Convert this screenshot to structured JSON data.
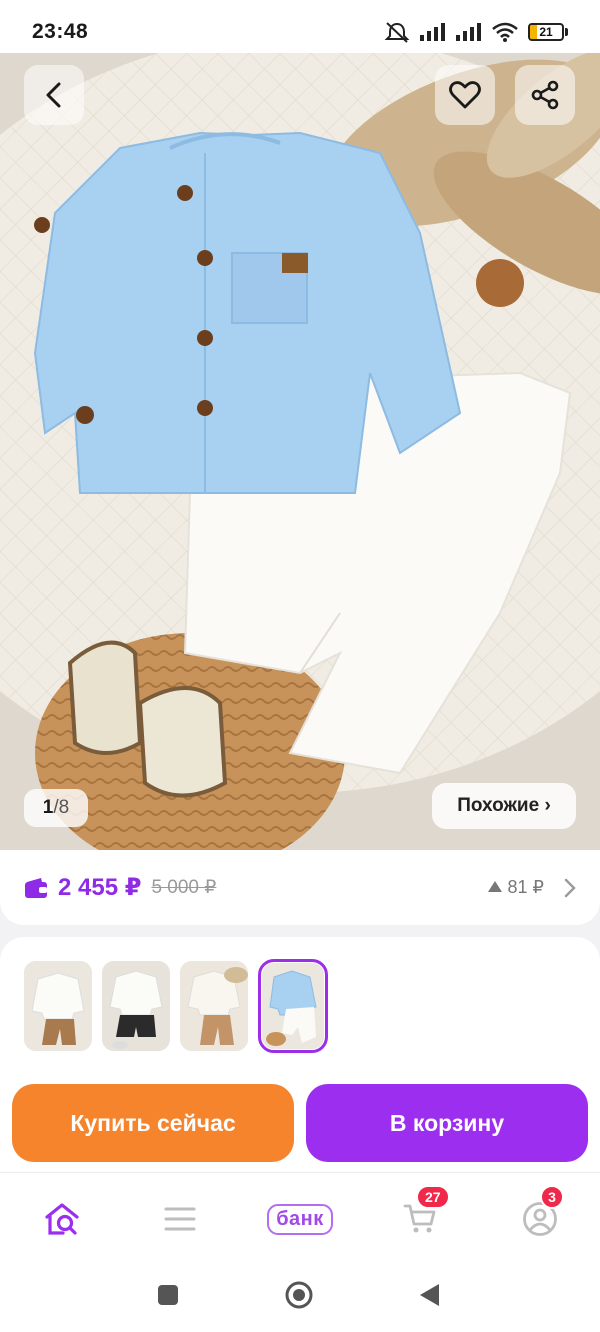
{
  "status_bar": {
    "time": "23:48",
    "battery_level": "21",
    "battery_fraction": 0.21,
    "icons": [
      "mute-icon",
      "signal-icon",
      "signal-icon",
      "wifi-icon",
      "battery-icon"
    ]
  },
  "product_image": {
    "counter_current": "1",
    "counter_separator": "/",
    "counter_total": "8",
    "similar_label": "Похожие ›"
  },
  "price": {
    "current": "2 455 ₽",
    "old": "5 000 ₽",
    "points": "81 ₽"
  },
  "variants": {
    "selected_index": 3,
    "items": [
      "white-shirt-brown-pants",
      "white-shirt-black-shorts",
      "white-shirt-brown-pants-2",
      "blue-shirt-white-pants"
    ]
  },
  "actions": {
    "buy_now": "Купить сейчас",
    "add_to_cart": "В корзину"
  },
  "bottom_nav": {
    "bank_label": "банк",
    "cart_count": "27",
    "profile_count": "3"
  },
  "colors": {
    "accent_purple": "#9c2ef0",
    "accent_orange": "#f5842d",
    "badge_red": "#f0284a"
  }
}
